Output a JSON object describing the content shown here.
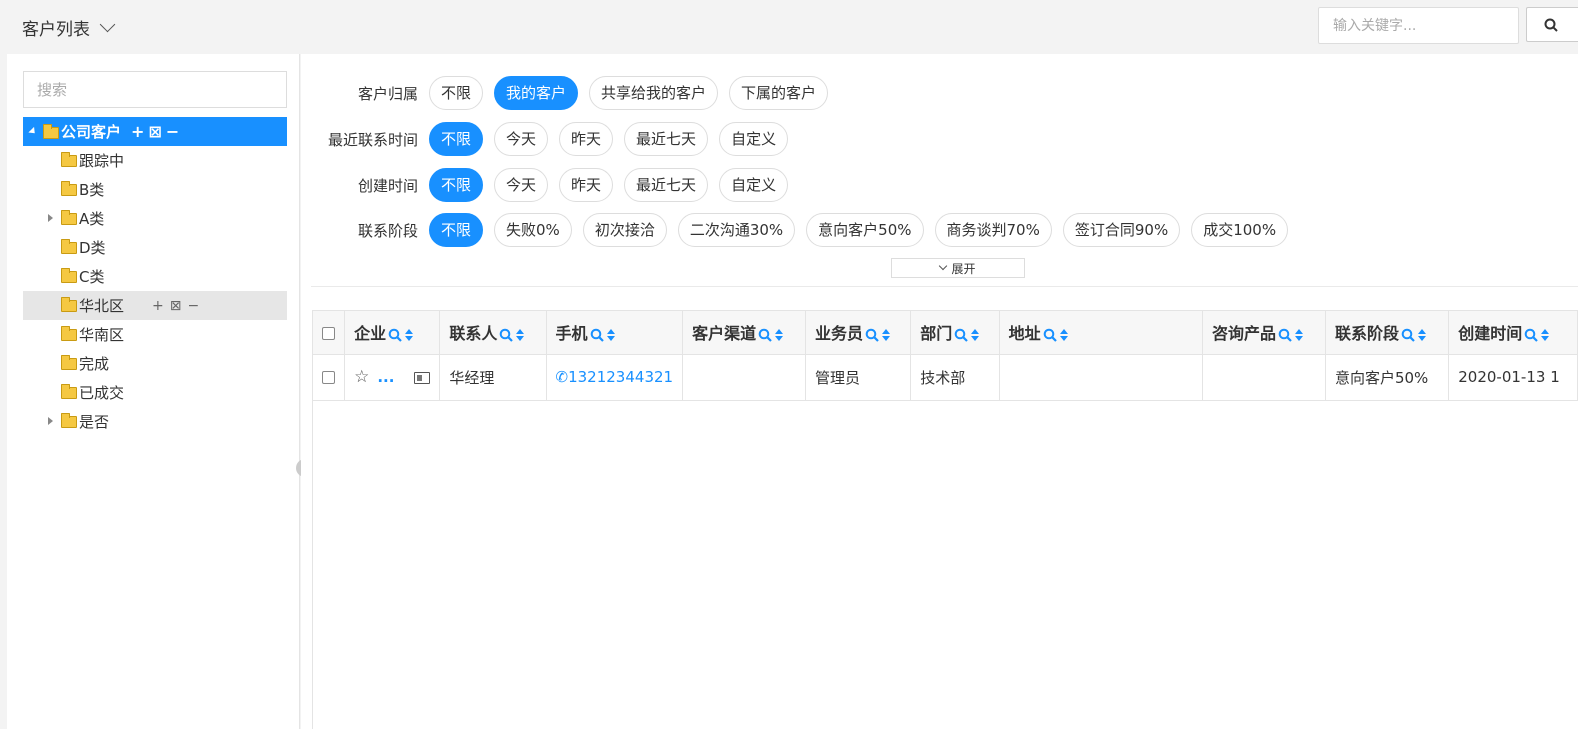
{
  "header": {
    "title": "客户列表",
    "keyword_placeholder": "输入关键字..."
  },
  "tree": {
    "search_placeholder": "搜索",
    "root": {
      "label": "公司客户",
      "actions": "+⊠−"
    },
    "items": [
      {
        "label": "跟踪中",
        "has_children": false
      },
      {
        "label": "B类",
        "has_children": false
      },
      {
        "label": "A类",
        "has_children": true
      },
      {
        "label": "D类",
        "has_children": false
      },
      {
        "label": "C类",
        "has_children": false
      },
      {
        "label": "华北区",
        "has_children": false,
        "hovered": true,
        "actions": "+⊠−"
      },
      {
        "label": "华南区",
        "has_children": false
      },
      {
        "label": "完成",
        "has_children": false
      },
      {
        "label": "已成交",
        "has_children": false
      },
      {
        "label": "是否",
        "has_children": true
      }
    ]
  },
  "filters": [
    {
      "label": "客户归属",
      "options": [
        "不限",
        "我的客户",
        "共享给我的客户",
        "下属的客户"
      ],
      "selected": 1
    },
    {
      "label": "最近联系时间",
      "options": [
        "不限",
        "今天",
        "昨天",
        "最近七天",
        "自定义"
      ],
      "selected": 0
    },
    {
      "label": "创建时间",
      "options": [
        "不限",
        "今天",
        "昨天",
        "最近七天",
        "自定义"
      ],
      "selected": 0
    },
    {
      "label": "联系阶段",
      "options": [
        "不限",
        "失败0%",
        "初次接洽",
        "二次沟通30%",
        "意向客户50%",
        "商务谈判70%",
        "签订合同90%",
        "成交100%"
      ],
      "selected": 0
    }
  ],
  "expand_label": "展开",
  "table": {
    "columns": [
      "企业",
      "联系人",
      "手机",
      "客户渠道",
      "业务员",
      "部门",
      "地址",
      "咨询产品",
      "联系阶段",
      "创建时间"
    ],
    "rows": [
      {
        "company": "...",
        "contact": "华经理",
        "phone": "13212344321",
        "channel": "",
        "salesperson": "管理员",
        "department": "技术部",
        "address": "",
        "product": "",
        "stage": "意向客户50%",
        "created": "2020-01-13 1"
      }
    ]
  },
  "colors": {
    "accent": "#1890ff",
    "hover_bg": "#e6e6e6"
  }
}
